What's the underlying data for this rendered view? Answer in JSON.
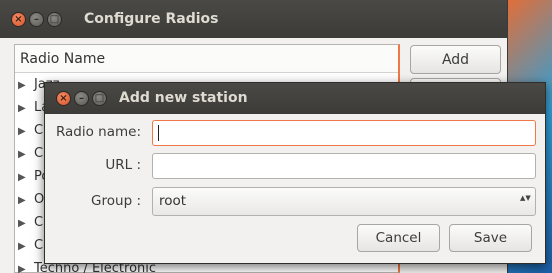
{
  "configure_window": {
    "title": "Configure Radios",
    "controls": {
      "close": "×",
      "minimize": "–",
      "maximize": "□"
    },
    "list": {
      "header": "Radio Name",
      "expander_glyph": "▶",
      "rows": [
        "Jazz",
        "La",
        "Cl",
        "Cl",
        "Po",
        "Ol",
        "Ch",
        "Co",
        "Techno / Electronic"
      ]
    },
    "buttons": {
      "add": "Add"
    }
  },
  "dialog": {
    "title": "Add new station",
    "controls": {
      "close": "×",
      "minimize": "–",
      "maximize": "□"
    },
    "fields": {
      "radio_name": {
        "label": "Radio name:",
        "value": ""
      },
      "url": {
        "label": "URL :",
        "value": ""
      },
      "group": {
        "label": "Group :",
        "value": "root",
        "arrows": "▲▼"
      }
    },
    "buttons": {
      "cancel": "Cancel",
      "save": "Save"
    }
  }
}
